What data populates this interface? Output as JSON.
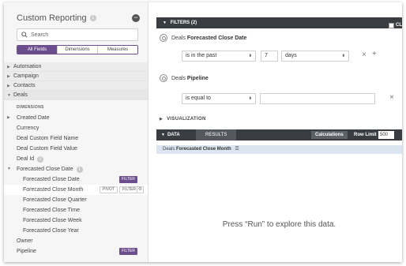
{
  "app": {
    "title": "Custom Reporting",
    "info_icon": "info-icon",
    "collapse_icon": "minus-circle-icon"
  },
  "sidebar": {
    "search": {
      "placeholder": "Search",
      "icon": "search-icon"
    },
    "segments": [
      {
        "label": "All Fields",
        "active": true
      },
      {
        "label": "Dimensions",
        "active": false
      },
      {
        "label": "Measures",
        "active": false
      }
    ],
    "categories": [
      {
        "label": "Automation",
        "expanded": false
      },
      {
        "label": "Campaign",
        "expanded": false
      },
      {
        "label": "Contacts",
        "expanded": false
      },
      {
        "label": "Deals",
        "expanded": true
      }
    ],
    "dimensions_heading": "DIMENSIONS",
    "fields": [
      {
        "label": "Created Date",
        "caret": true
      },
      {
        "label": "Currency"
      },
      {
        "label": "Deal Custom Field Name"
      },
      {
        "label": "Deal Custom Field Value"
      },
      {
        "label": "Deal Id",
        "info": true
      },
      {
        "label": "Forecasted Close Date",
        "caret": true,
        "expanded": true,
        "info": true
      },
      {
        "label": "Forecasted Close Date",
        "sub": true,
        "tags": [
          "FILTER"
        ]
      },
      {
        "label": "Forecasted Close Month",
        "sub": true,
        "hover": true,
        "tags": [
          "PIVOT",
          "FILTER"
        ]
      },
      {
        "label": "Forecasted Close Quarter",
        "sub": true
      },
      {
        "label": "Forecasted Close Time",
        "sub": true
      },
      {
        "label": "Forecasted Close Week",
        "sub": true
      },
      {
        "label": "Forecasted Close Year",
        "sub": true
      },
      {
        "label": "Owner"
      },
      {
        "label": "Pipeline",
        "tags": [
          "FILTER"
        ]
      }
    ]
  },
  "filters": {
    "header": "FILTERS (2)",
    "clear_label": "CL",
    "rows": [
      {
        "prefix": "Deals",
        "field": "Forecasted Close Date",
        "operator": "is in the past",
        "value": "7",
        "unit": "days"
      },
      {
        "prefix": "Deals",
        "field": "Pipeline",
        "operator": "is equal to",
        "value": ""
      }
    ]
  },
  "visualization": {
    "label": "VISUALIZATION"
  },
  "data": {
    "tab_data": "DATA",
    "tab_results": "RESULTS",
    "calculations": "Calculations",
    "row_limit_label": "Row Limit",
    "row_limit_value": "500",
    "column_prefix": "Deals",
    "column_field": "Forecasted Close Month",
    "empty_message": "Press “Run” to explore this data."
  },
  "colors": {
    "accent": "#6c4e8e",
    "dark_bar": "#393c41",
    "column_header_bg": "#dbe5ef"
  }
}
